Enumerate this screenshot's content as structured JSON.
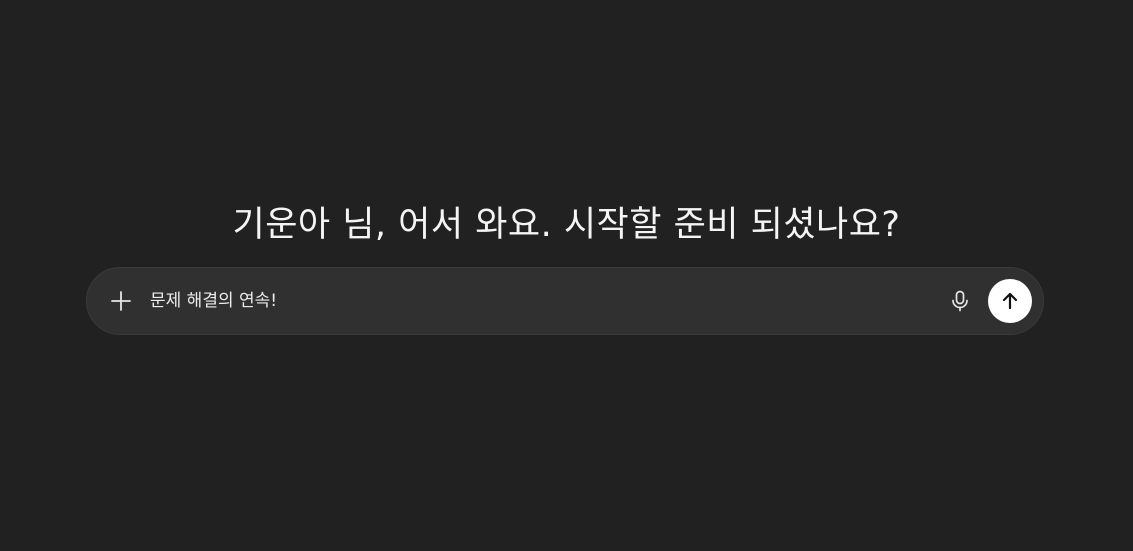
{
  "greeting": {
    "text": "기운아 님, 어서 와요. 시작할 준비 되셨나요?"
  },
  "composer": {
    "input_value": "문제 해결의 연속!",
    "icons": {
      "attach": "plus-icon",
      "voice": "microphone-icon",
      "send": "arrow-up-icon"
    }
  },
  "colors": {
    "background": "#212121",
    "composer_bg": "#303030",
    "send_button_bg": "#ffffff",
    "text": "#ececec"
  }
}
